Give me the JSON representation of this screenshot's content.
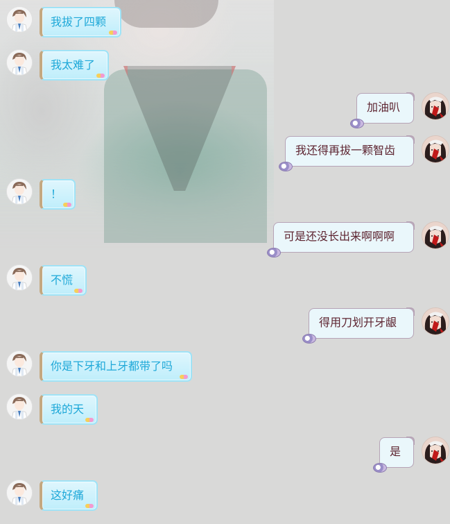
{
  "messages": [
    {
      "side": "left",
      "text": "我拔了四颗"
    },
    {
      "side": "left",
      "text": "我太难了"
    },
    {
      "side": "right",
      "text": "加油叭"
    },
    {
      "side": "right",
      "text": "我还得再拔一颗智齿"
    },
    {
      "side": "left",
      "text": "！"
    },
    {
      "side": "right",
      "text": "可是还没长出来啊啊啊"
    },
    {
      "side": "left",
      "text": "不慌"
    },
    {
      "side": "right",
      "text": "得用刀划开牙龈"
    },
    {
      "side": "left",
      "text": "你是下牙和上牙都带了吗"
    },
    {
      "side": "left",
      "text": "我的天"
    },
    {
      "side": "right",
      "text": "是"
    },
    {
      "side": "left",
      "text": "这好痛"
    }
  ],
  "avatars": {
    "left": "boy-avatar-icon",
    "right": "girl-avatar-icon"
  },
  "colors": {
    "background": "#d9d9d8",
    "left_bubble_text": "#1ea8d8",
    "left_bubble_border": "#9ee3f7",
    "right_bubble_text": "#5d2430",
    "right_bubble_border": "#b6a3b6"
  }
}
